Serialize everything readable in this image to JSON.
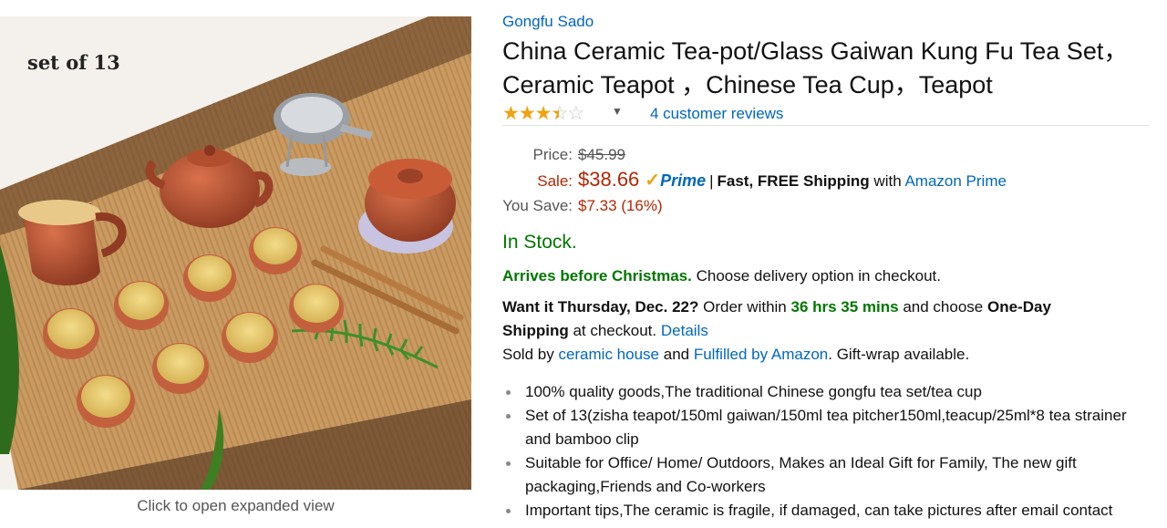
{
  "image": {
    "overlay_text": "set of 13",
    "expand_label": "Click to open expanded view"
  },
  "product": {
    "brand": "Gongfu Sado",
    "title": "China Ceramic Tea-pot/Glass Gaiwan Kung Fu Tea Set，Ceramic Teapot ，Chinese Tea Cup，Teapot",
    "rating": {
      "stars": 3.5,
      "out_of": 5
    },
    "reviews_label": "4 customer reviews"
  },
  "price": {
    "list_label": "Price:",
    "list_value": "$45.99",
    "sale_label": "Sale:",
    "sale_value": "$38.66",
    "prime_mark": "✓",
    "prime_word": "Prime",
    "pipe": "|",
    "shipping_bold": "Fast, FREE Shipping",
    "shipping_with": "with",
    "shipping_link": "Amazon Prime",
    "save_label": "You Save:",
    "save_value": "$7.33 (16%)"
  },
  "availability": {
    "stock": "In Stock.",
    "arrives_bold": "Arrives before Christmas.",
    "arrives_rest": "Choose delivery option in checkout.",
    "want_bold": "Want it Thursday, Dec. 22?",
    "order_within": "Order within",
    "time_left": "36 hrs 35 mins",
    "and_choose": "and choose",
    "one_day": "One-Day",
    "shipping_word": "Shipping",
    "at_checkout": "at checkout.",
    "details_link": "Details",
    "sold_by": "Sold by",
    "seller": "ceramic house",
    "and_word": "and",
    "fulfilled": "Fulfilled by Amazon",
    "giftwrap": ". Gift-wrap available."
  },
  "bullets": [
    "100% quality goods,The traditional Chinese gongfu tea set/tea cup",
    "Set of 13(zisha teapot/150ml gaiwan/150ml tea pitcher150ml,teacup/25ml*8 tea strainer and bamboo clip",
    "Suitable for Office/ Home/ Outdoors, Makes an Ideal Gift for Family, The new gift packaging,Friends and Co-workers",
    "Important tips,The ceramic is fragile, if damaged, can take pictures after email contact"
  ],
  "colors": {
    "link": "#0066c0",
    "price_red": "#b12704",
    "stock_green": "#007600",
    "star": "#f0a20f"
  }
}
